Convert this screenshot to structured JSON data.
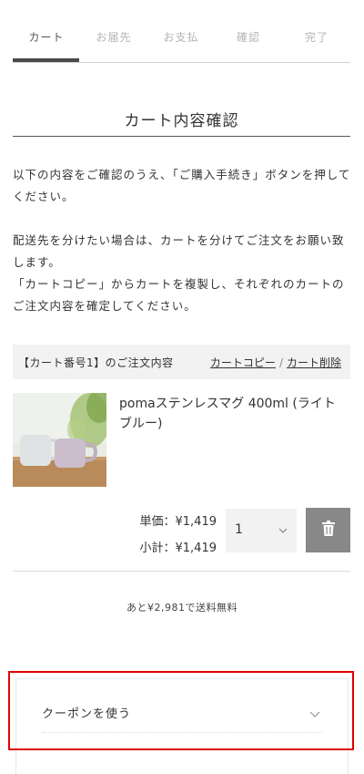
{
  "steps": [
    {
      "label": "カート",
      "active": true
    },
    {
      "label": "お届先",
      "active": false
    },
    {
      "label": "お支払",
      "active": false
    },
    {
      "label": "確認",
      "active": false
    },
    {
      "label": "完了",
      "active": false
    }
  ],
  "page_title": "カート内容確認",
  "intro": {
    "line1": "以下の内容をご確認のうえ、「ご購入手続き」ボタンを押してください。",
    "line2": "配送先を分けたい場合は、カートを分けてご注文をお願い致します。",
    "line3": "「カートコピー」からカートを複製し、それぞれのカートのご注文内容を確定してください。"
  },
  "cart": {
    "header_label": "【カート番号1】のご注文内容",
    "copy_link": "カートコピー",
    "separator": "/",
    "delete_link": "カート削除",
    "item": {
      "name": "pomaステンレスマグ 400ml (ライトブルー)",
      "unit_price": "単価：¥1,419",
      "subtotal": "小計：¥1,419",
      "quantity": "1"
    },
    "shipping_note": "あと¥2,981で送料無料"
  },
  "coupon": {
    "label": "クーポンを使う"
  },
  "colors": {
    "highlight": "#e00000",
    "delete_button": "#888888",
    "panel_bg": "#f2f2f2"
  }
}
